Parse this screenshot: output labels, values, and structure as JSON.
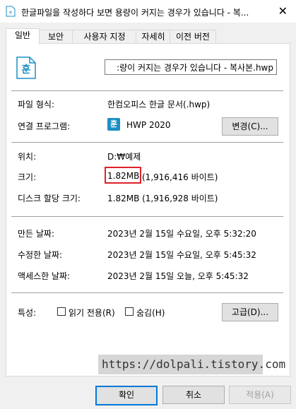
{
  "title": "한글파일을 작성하다 보면 용량이 커지는 경우가 있습니다 - 복...",
  "tabs": [
    "일반",
    "보안",
    "사용자 지정",
    "자세히",
    "이전 버전"
  ],
  "filename": ":량이 커지는 경우가 있습니다 - 복사본.hwp",
  "general": {
    "type_label": "파일 형식:",
    "type_value": "한컴오피스 한글 문서(.hwp)",
    "program_label": "연결 프로그램:",
    "program_value": "HWP 2020",
    "change_button": "변경(C)...",
    "location_label": "위치:",
    "location_value": "D:₩예제",
    "size_label": "크기:",
    "size_value": "1.82MB",
    "size_bytes": "(1,916,416 바이트)",
    "disk_label": "디스크 할당 크기:",
    "disk_value": "1.82MB (1,916,928 바이트)",
    "created_label": "만든 날짜:",
    "created_value": "2023년 2월 15일 수요일, 오후 5:32:20",
    "modified_label": "수정한 날짜:",
    "modified_value": "2023년 2월 15일 수요일, 오후 5:45:32",
    "accessed_label": "액세스한 날짜:",
    "accessed_value": "2023년 2월 15일 오늘, 오후 5:45:32",
    "attr_label": "특성:",
    "readonly_label": "읽기 전용(R)",
    "hidden_label": "숨김(H)",
    "advanced_button": "고급(D)..."
  },
  "watermark": "https://dolpali.tistory.com",
  "buttons": {
    "ok": "확인",
    "cancel": "취소",
    "apply": "적용(A)"
  },
  "icon_color": "#1b8fc4"
}
